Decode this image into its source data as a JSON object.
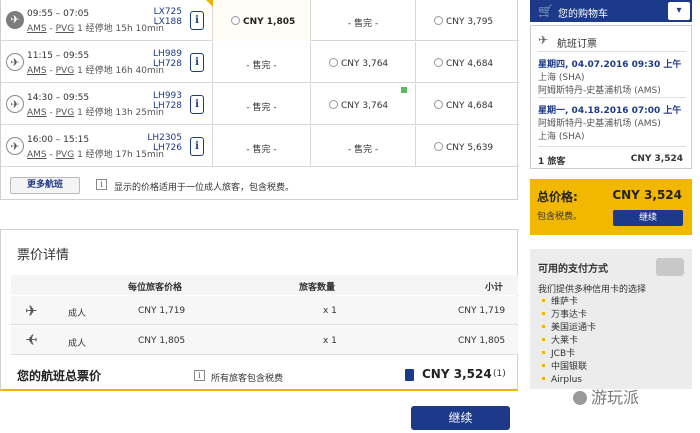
{
  "flights": [
    {
      "depart": "09:55",
      "arrive": "07:05",
      "from": "AMS",
      "to": "PVG",
      "stops": "1 经停地",
      "duration": "15h 10min",
      "flight_nums": [
        "LX725",
        "LX188"
      ],
      "airline_icon": "swiss-plane-icon",
      "fares": [
        {
          "type": "price",
          "value": "CNY 1,805",
          "selected": true
        },
        {
          "type": "soldout",
          "value": "- 售完 -"
        },
        {
          "type": "price",
          "value": "CNY 3,795"
        }
      ]
    },
    {
      "depart": "11:15",
      "arrive": "09:55",
      "from": "AMS",
      "to": "PVG",
      "stops": "1 经停地",
      "duration": "16h 40min",
      "flight_nums": [
        "LH989",
        "LH728"
      ],
      "airline_icon": "lufthansa-crane-icon",
      "fares": [
        {
          "type": "soldout",
          "value": "- 售完 -"
        },
        {
          "type": "price",
          "value": "CNY 3,764"
        },
        {
          "type": "price",
          "value": "CNY 4,684"
        }
      ]
    },
    {
      "depart": "14:30",
      "arrive": "09:55",
      "from": "AMS",
      "to": "PVG",
      "stops": "1 经停地",
      "duration": "13h 25min",
      "flight_nums": [
        "LH993",
        "LH728"
      ],
      "airline_icon": "lufthansa-crane-icon",
      "fares": [
        {
          "type": "soldout",
          "value": "- 售完 -"
        },
        {
          "type": "price",
          "value": "CNY 3,764"
        },
        {
          "type": "price",
          "value": "CNY 4,684"
        }
      ]
    },
    {
      "depart": "16:00",
      "arrive": "15:15",
      "from": "AMS",
      "to": "PVG",
      "stops": "1 经停地",
      "duration": "17h 15min",
      "flight_nums": [
        "LH2305",
        "LH726"
      ],
      "airline_icon": "lufthansa-crane-icon",
      "fares": [
        {
          "type": "soldout",
          "value": "- 售完 -"
        },
        {
          "type": "soldout",
          "value": "- 售完 -"
        },
        {
          "type": "price",
          "value": "CNY 5,639"
        }
      ]
    }
  ],
  "more_flights_label": "更多航班",
  "price_note": "显示的价格适用于一位成人旅客，包含税费。",
  "fare_details": {
    "title": "票价详情",
    "headers": {
      "per_pax": "每位旅客价格",
      "count": "旅客数量",
      "subtotal": "小计"
    },
    "rows": [
      {
        "icon": "departure-plane-icon",
        "type": "成人",
        "price": "CNY 1,719",
        "count": "x 1",
        "subtotal": "CNY 1,719"
      },
      {
        "icon": "arrival-plane-icon",
        "type": "成人",
        "price": "CNY 1,805",
        "count": "x 1",
        "subtotal": "CNY 1,805"
      }
    ],
    "total_label": "您的航班总票价",
    "total_note": "所有旅客包含税费",
    "total_value": "CNY 3,524",
    "total_footnote": "(1)"
  },
  "continue_label": "继续",
  "cart": {
    "title": "您的购物车",
    "toggle_icon": "chevron-down-icon",
    "trip_title": "航班订票",
    "outbound": {
      "date": "星期四, 04.07.2016 09:30 上午",
      "from": "上海 (SHA)",
      "to": "阿姆斯特丹-史基浦机场 (AMS)"
    },
    "inbound": {
      "date": "星期一, 04.18.2016 07:00 上午",
      "from": "阿姆斯特丹-史基浦机场 (AMS)",
      "to": "上海 (SHA)"
    },
    "pax_label": "1 旅客",
    "pax_value": "CNY 3,524"
  },
  "total_box": {
    "label": "总价格:",
    "value": "CNY 3,524",
    "note": "包含税费。",
    "button": "继续"
  },
  "payment": {
    "title": "可用的支付方式",
    "subtitle": "我们提供多种信用卡的选择",
    "methods": [
      "维萨卡",
      "万事达卡",
      "美国运通卡",
      "大莱卡",
      "JCB卡",
      "中国银联",
      "Airplus"
    ]
  },
  "watermark": "游玩派",
  "colors": {
    "brand_blue": "#1d3a8a",
    "accent_yellow": "#f2b800"
  }
}
